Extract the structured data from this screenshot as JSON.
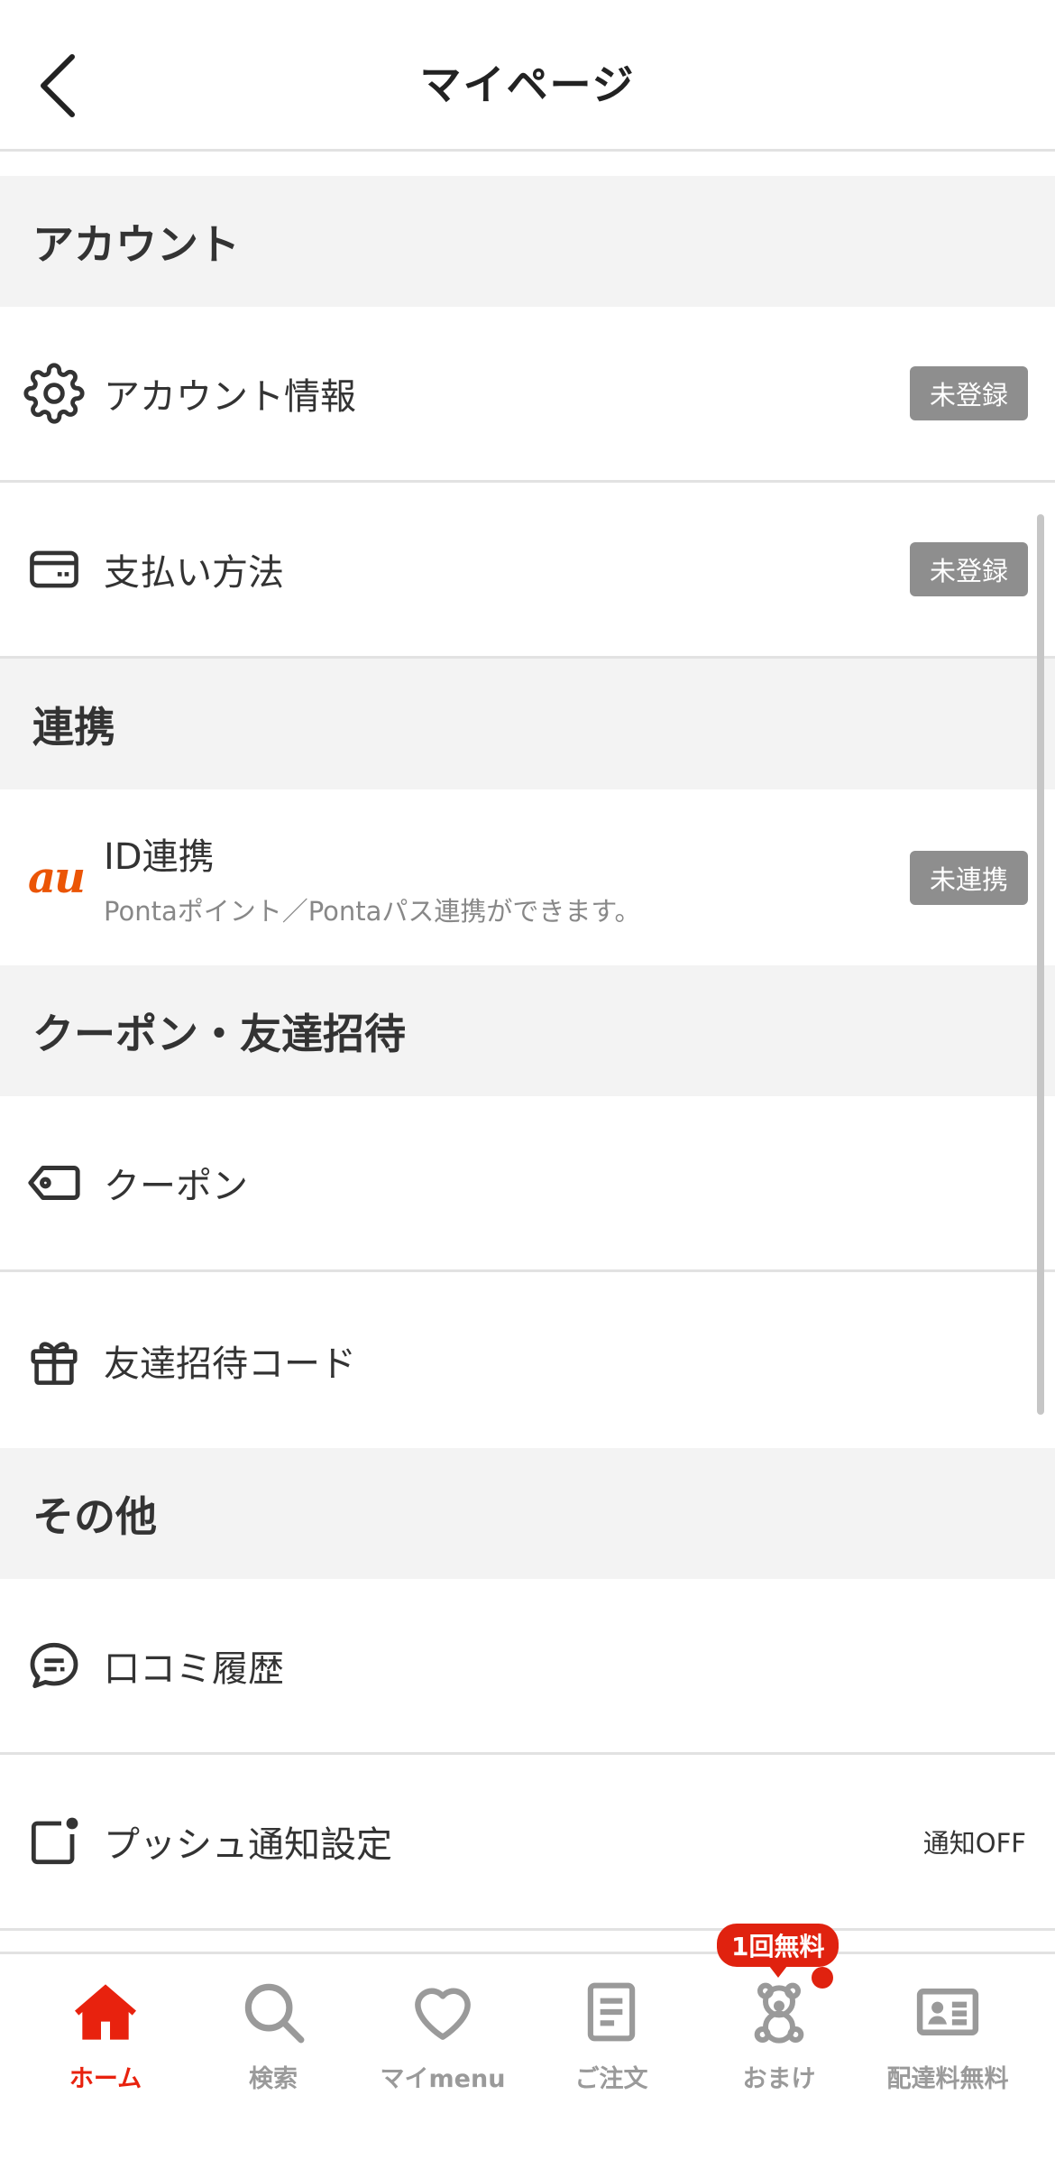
{
  "header": {
    "title": "マイページ",
    "back_icon": "chevron-left-icon"
  },
  "sections": {
    "account": {
      "title": "アカウント",
      "items": {
        "account_info": {
          "label": "アカウント情報",
          "badge": "未登録",
          "icon": "gear-icon"
        },
        "payment": {
          "label": "支払い方法",
          "badge": "未登録",
          "icon": "credit-card-icon"
        }
      }
    },
    "linkage": {
      "title": "連携",
      "items": {
        "id_link": {
          "logo": "au",
          "label": "ID連携",
          "sub": "Pontaポイント／Pontaパス連携ができます。",
          "badge": "未連携",
          "icon": "au-logo"
        }
      }
    },
    "coupon": {
      "title": "クーポン・友達招待",
      "items": {
        "coupon": {
          "label": "クーポン",
          "icon": "tag-icon"
        },
        "invite": {
          "label": "友達招待コード",
          "icon": "gift-icon"
        }
      }
    },
    "other": {
      "title": "その他",
      "items": {
        "reviews": {
          "label": "口コミ履歴",
          "icon": "chat-bubble-icon"
        },
        "push": {
          "label": "プッシュ通知設定",
          "status": "通知OFF",
          "icon": "notification-square-icon"
        }
      }
    }
  },
  "tabbar": {
    "home": {
      "label": "ホーム",
      "icon": "home-icon"
    },
    "search": {
      "label": "検索",
      "icon": "search-icon"
    },
    "mymenu": {
      "label": "マイmenu",
      "icon": "heart-icon"
    },
    "orders": {
      "label": "ご注文",
      "icon": "document-icon"
    },
    "omake": {
      "label": "おまけ",
      "icon": "bear-icon",
      "promo": "1回無料"
    },
    "delivery": {
      "label": "配達料無料",
      "icon": "id-card-icon"
    }
  },
  "colors": {
    "accent": "#e8220e",
    "badge": "#8e8e8e",
    "section_bg": "#f3f3f3",
    "au_orange": "#eb5505"
  }
}
